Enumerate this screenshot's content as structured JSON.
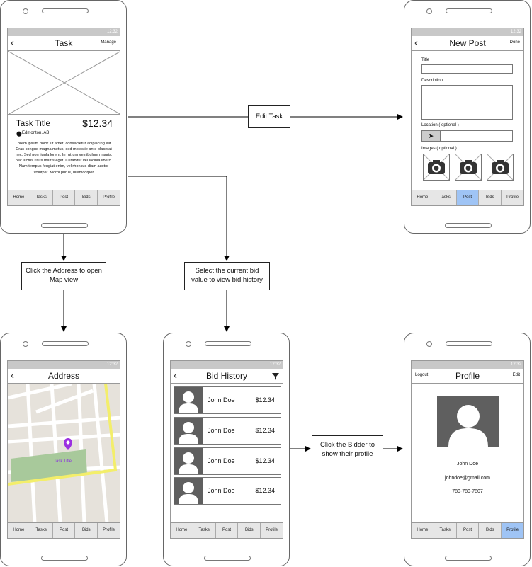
{
  "status_time": "12:32",
  "tabs": [
    "Home",
    "Tasks",
    "Post",
    "Bids",
    "Profile"
  ],
  "task_screen": {
    "title": "Task",
    "right_action": "Manage",
    "task_title": "Task Title",
    "price": "$12.34",
    "location": "Edmonton, AB",
    "body": "Lorem ipsum dolor sit amet, consectetur adipiscing elit. Cras congue magna metus, sed molestie ante placerat nec. Sed non ligula lorem. In rutrum vestibulum mauris, nec luctus risus mattis eget. Curabitur vel lacinia libero. Nam tempus feugiat enim, vel rhoncus diam auctor volutpat. Morbi purus, ullamcorper"
  },
  "new_post_screen": {
    "title": "New Post",
    "right_action": "Done",
    "title_label": "Title",
    "description_label": "Description",
    "location_label": "Location ( optional )",
    "images_label": "Images ( optional )",
    "active_tab": "Post"
  },
  "address_screen": {
    "title": "Address",
    "pin_label": "Task Title"
  },
  "bid_history_screen": {
    "title": "Bid History",
    "bids": [
      {
        "name": "John Doe",
        "price": "$12.34"
      },
      {
        "name": "John Doe",
        "price": "$12.34"
      },
      {
        "name": "John Doe",
        "price": "$12.34"
      },
      {
        "name": "John Doe",
        "price": "$12.34"
      }
    ]
  },
  "profile_screen": {
    "title": "Profile",
    "left_action": "Logout",
    "right_action": "Edit",
    "name": "John Doe",
    "email": "johndoe@gmail.com",
    "phone": "780-780-7807",
    "active_tab": "Profile"
  },
  "flow_labels": {
    "edit_task": "Edit Task",
    "open_map": "Click the Address to open Map view",
    "bid_history": "Select the current bid value to view bid history",
    "show_profile": "Click the Bidder to show their profile"
  },
  "colors": {
    "active_tab": "#9fc4f5",
    "map_road_yellow": "#f3ee6a",
    "map_park": "#a8c99b",
    "pin": "#9b30e0"
  }
}
